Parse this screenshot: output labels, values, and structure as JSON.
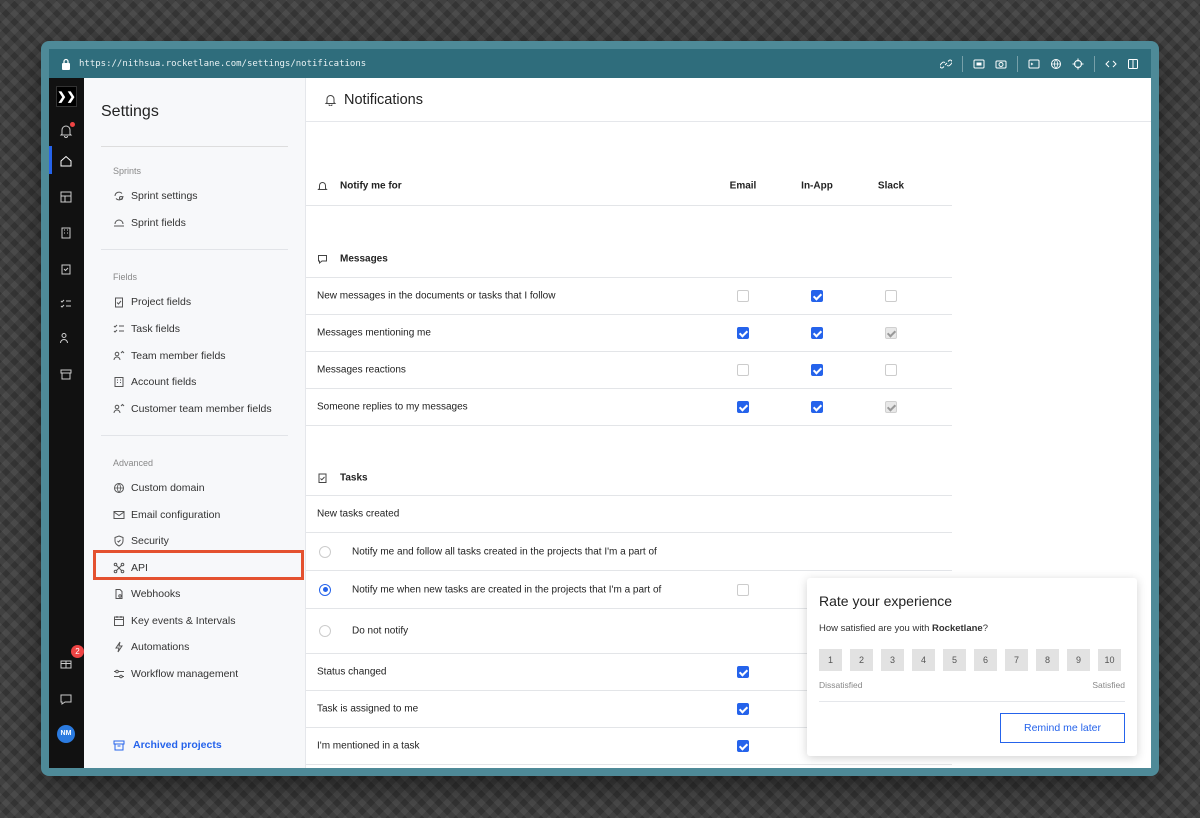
{
  "browser": {
    "url": "https://nithsua.rocketlane.com/settings/notifications"
  },
  "rail": {
    "notification_badge": "2",
    "avatar_initials": "NM"
  },
  "sidebar": {
    "title": "Settings",
    "sections": {
      "sprints": "Sprints",
      "fields": "Fields",
      "advanced": "Advanced"
    },
    "items": {
      "sprint_settings": "Sprint settings",
      "sprint_fields": "Sprint fields",
      "project_fields": "Project fields",
      "task_fields": "Task fields",
      "team_member_fields": "Team member fields",
      "account_fields": "Account fields",
      "customer_team_member_fields": "Customer team member fields",
      "custom_domain": "Custom domain",
      "email_configuration": "Email configuration",
      "security": "Security",
      "api": "API",
      "webhooks": "Webhooks",
      "key_events": "Key events & Intervals",
      "automations": "Automations",
      "workflow_management": "Workflow management"
    },
    "archived": "Archived projects"
  },
  "main": {
    "title": "Notifications",
    "columns": {
      "notify": "Notify me for",
      "email": "Email",
      "inapp": "In-App",
      "slack": "Slack"
    },
    "messages_heading": "Messages",
    "messages": [
      {
        "label": "New messages in the documents or tasks that I follow",
        "email": false,
        "inapp": true,
        "slack": false
      },
      {
        "label": "Messages mentioning me",
        "email": true,
        "inapp": true,
        "slack": "disabled-checked"
      },
      {
        "label": "Messages reactions",
        "email": false,
        "inapp": true,
        "slack": false
      },
      {
        "label": "Someone replies to my messages",
        "email": true,
        "inapp": true,
        "slack": "disabled-checked"
      }
    ],
    "tasks_heading": "Tasks",
    "new_tasks_label": "New tasks created",
    "new_task_options": [
      {
        "label": "Notify me and follow all tasks created in the projects that I'm a part of",
        "selected": false
      },
      {
        "label": "Notify me when new tasks are created in the projects that I'm a part of",
        "selected": true
      },
      {
        "label": "Do not notify",
        "selected": false
      }
    ],
    "task_rows": [
      {
        "label": "Status changed",
        "email": true
      },
      {
        "label": "Task is assigned to me",
        "email": true
      },
      {
        "label": "I'm mentioned in a task",
        "email": true
      }
    ]
  },
  "rating": {
    "title": "Rate your experience",
    "question_prefix": "How satisfied are you with ",
    "question_brand": "Rocketlane",
    "question_suffix": "?",
    "scale": [
      "1",
      "2",
      "3",
      "4",
      "5",
      "6",
      "7",
      "8",
      "9",
      "10"
    ],
    "low_label": "Dissatisfied",
    "high_label": "Satisfied",
    "remind_label": "Remind me later"
  },
  "colors": {
    "accent": "#2563eb",
    "highlight_border": "#e4512f",
    "browser_bar": "#2f6d7c"
  }
}
